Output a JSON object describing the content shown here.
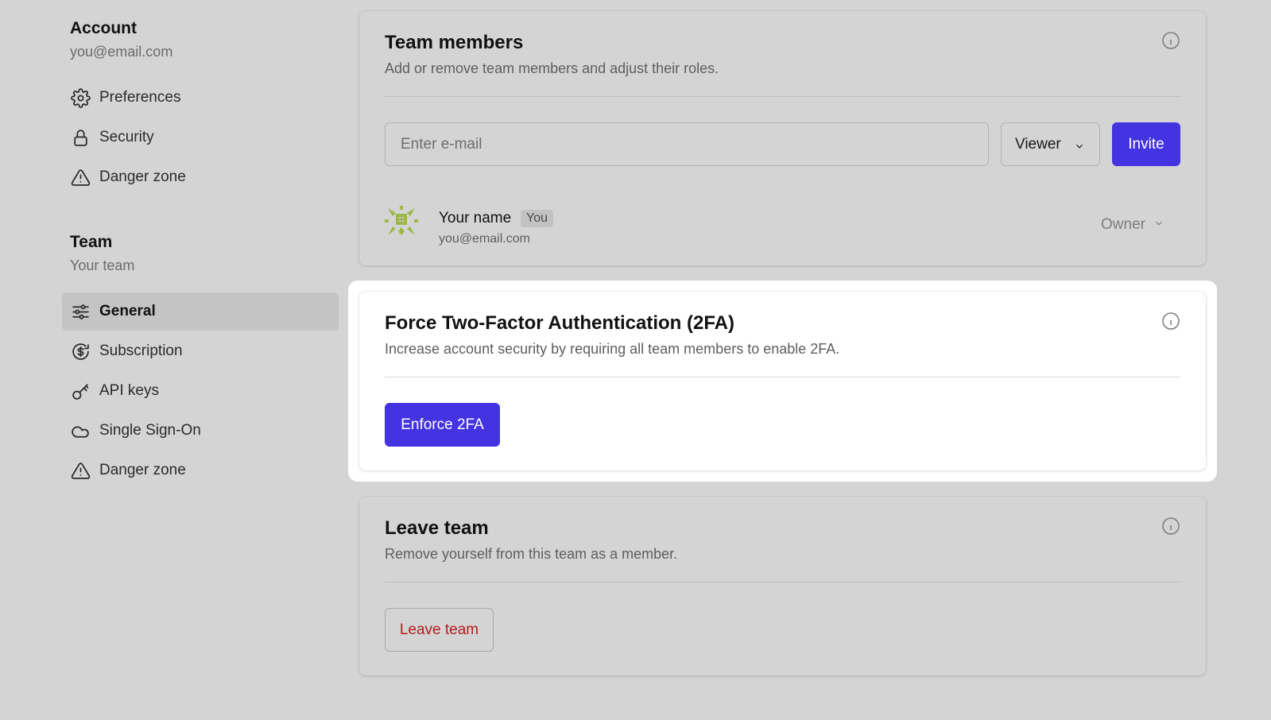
{
  "sidebar": {
    "account": {
      "title": "Account",
      "subtitle": "you@email.com",
      "items": [
        {
          "label": "Preferences",
          "icon": "gear-icon"
        },
        {
          "label": "Security",
          "icon": "lock-icon"
        },
        {
          "label": "Danger zone",
          "icon": "warning-icon"
        }
      ]
    },
    "team": {
      "title": "Team",
      "subtitle": "Your team",
      "items": [
        {
          "label": "General",
          "icon": "sliders-icon",
          "active": true
        },
        {
          "label": "Subscription",
          "icon": "dollar-icon"
        },
        {
          "label": "API keys",
          "icon": "key-icon"
        },
        {
          "label": "Single Sign-On",
          "icon": "cloud-icon"
        },
        {
          "label": "Danger zone",
          "icon": "warning-icon"
        }
      ]
    }
  },
  "members_card": {
    "title": "Team members",
    "description": "Add or remove team members and adjust their roles.",
    "email_placeholder": "Enter e-mail",
    "role_value": "Viewer",
    "invite_label": "Invite",
    "member": {
      "name": "Your name",
      "badge": "You",
      "email": "you@email.com",
      "role": "Owner"
    }
  },
  "twofa_card": {
    "title": "Force Two-Factor Authentication (2FA)",
    "description": "Increase account security by requiring all team members to enable 2FA.",
    "button_label": "Enforce 2FA"
  },
  "leave_card": {
    "title": "Leave team",
    "description": "Remove yourself from this team as a member.",
    "button_label": "Leave team"
  },
  "colors": {
    "accent": "#4433e0",
    "danger": "#b51d1d",
    "background": "#d4d4d4"
  }
}
